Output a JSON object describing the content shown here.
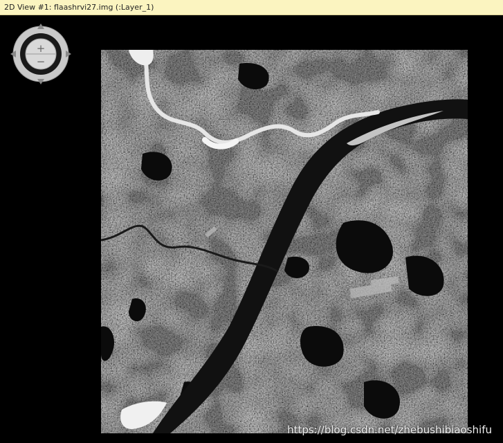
{
  "window": {
    "title": "2D View #1: flaashrvi27.img (:Layer_1)"
  },
  "navigator": {
    "zoom_in_symbol": "+",
    "zoom_out_symbol": "−",
    "ring_color": "#c9c9c9",
    "arrow_color": "#8a8a8a"
  },
  "watermark": {
    "text": "https://blog.csdn.net/zhebushibiaoshifu"
  },
  "colors": {
    "titlebar": "#fbf4c0",
    "background": "#000000"
  }
}
